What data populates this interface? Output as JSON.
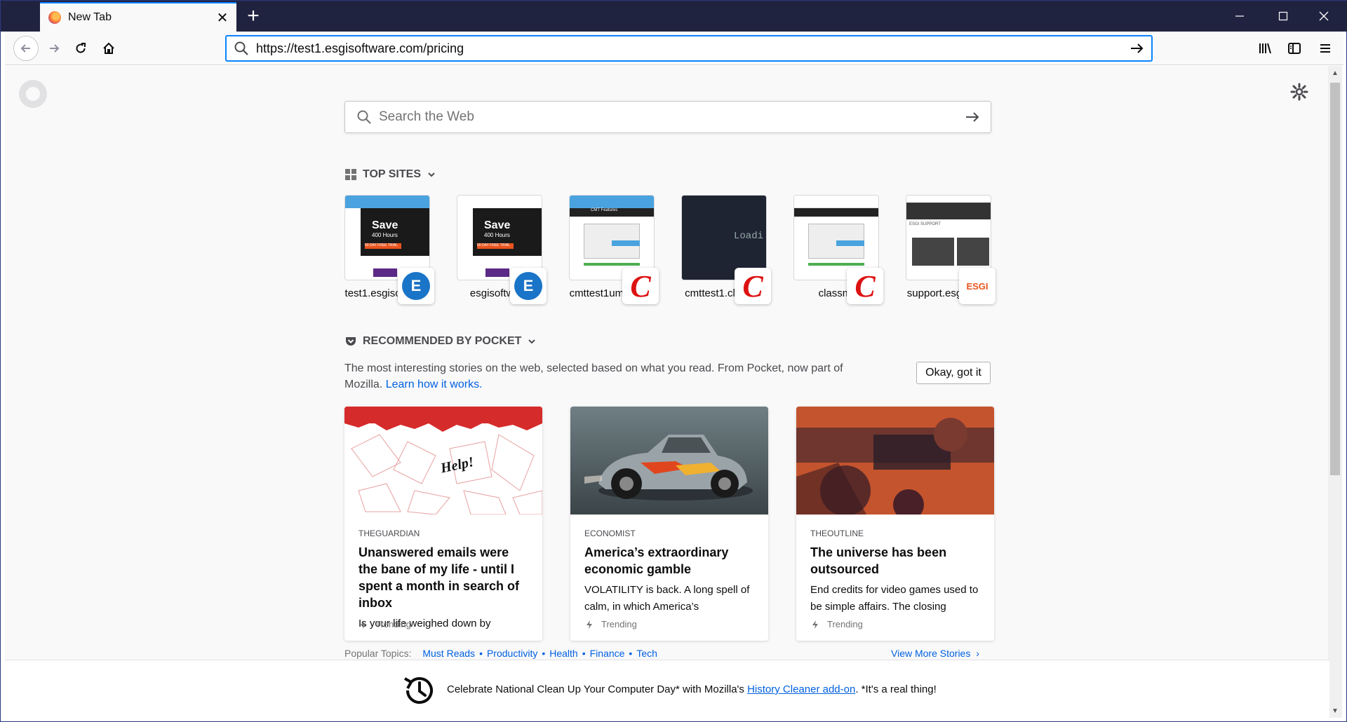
{
  "browser": {
    "tab_title": "New Tab",
    "new_tab_symbol": "+",
    "url": "https://test1.esgisoftware.com/pricing"
  },
  "newtab": {
    "search_placeholder": "Search the Web",
    "top_sites_heading": "TOP SITES",
    "top_sites": [
      {
        "label": "test1.esgisoftware",
        "badge": "E"
      },
      {
        "label": "esgisoftware",
        "badge": "E"
      },
      {
        "label": "cmttest1um.clas...",
        "badge": "C"
      },
      {
        "label": "cmttest1.classmt",
        "badge": "C"
      },
      {
        "label": "classmt",
        "badge": "C"
      },
      {
        "label": "support.esgisoft...",
        "badge": "ESGI"
      }
    ],
    "thumb_texts": {
      "esgi_save": "Save",
      "esgi_hours": "400 Hours",
      "esgi_free": "60 DAY FREE TRIAL",
      "cmt_header": "CMT Features",
      "loading": "Loadi",
      "support": "ESGI SUPPORT"
    },
    "pocket_heading": "RECOMMENDED BY POCKET",
    "pocket_desc": "The most interesting stories on the web, selected based on what you read. From Pocket, now part of Mozilla.",
    "pocket_learn": "Learn how it works.",
    "okay_button": "Okay, got it",
    "cards": [
      {
        "source": "THEGUARDIAN",
        "headline": "Unanswered emails were the bane of my life - until I spent a month in search of inbox",
        "excerpt": "Is your life weighed down by",
        "trend": "Trending",
        "image_text": "Help!"
      },
      {
        "source": "ECONOMIST",
        "headline": "America’s extraordinary economic gamble",
        "excerpt": "VOLATILITY is back. A long spell of calm, in which America’s",
        "trend": "Trending"
      },
      {
        "source": "THEOUTLINE",
        "headline": "The universe has been outsourced",
        "excerpt": "End credits for video games used to be simple affairs. The closing credits",
        "trend": "Trending"
      }
    ],
    "popular_topics_label": "Popular Topics:",
    "topics": [
      "Must Reads",
      "Productivity",
      "Health",
      "Finance",
      "Tech"
    ],
    "view_more": "View More Stories"
  },
  "snippet": {
    "text_before": "Celebrate National Clean Up Your Computer Day* with Mozilla's ",
    "link": "History Cleaner add-on",
    "text_after": ". *It's a real thing!"
  },
  "colors": {
    "tabbar": "#202340",
    "accent": "#0a84ff",
    "link": "#0060df"
  }
}
